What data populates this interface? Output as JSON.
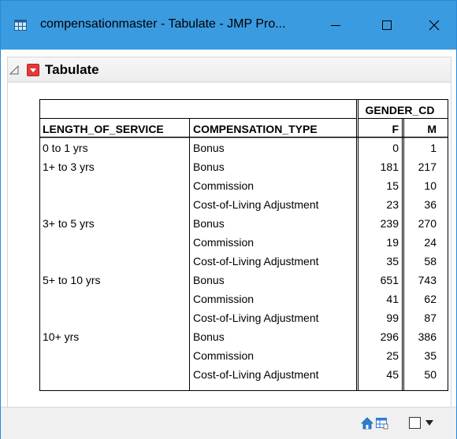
{
  "window": {
    "title": "compensationmaster - Tabulate - JMP Pro..."
  },
  "outline": {
    "title": "Tabulate"
  },
  "table": {
    "group_header": "GENDER_CD",
    "columns": [
      "LENGTH_OF_SERVICE",
      "COMPENSATION_TYPE",
      "F",
      "M"
    ],
    "rows": [
      [
        "0 to 1 yrs",
        "Bonus",
        "0",
        "1"
      ],
      [
        "1+ to 3 yrs",
        "Bonus",
        "181",
        "217"
      ],
      [
        "",
        "Commission",
        "15",
        "10"
      ],
      [
        "",
        "Cost-of-Living Adjustment",
        "23",
        "36"
      ],
      [
        "3+ to 5 yrs",
        "Bonus",
        "239",
        "270"
      ],
      [
        "",
        "Commission",
        "19",
        "24"
      ],
      [
        "",
        "Cost-of-Living Adjustment",
        "35",
        "58"
      ],
      [
        "5+ to 10 yrs",
        "Bonus",
        "651",
        "743"
      ],
      [
        "",
        "Commission",
        "41",
        "62"
      ],
      [
        "",
        "Cost-of-Living Adjustment",
        "99",
        "87"
      ],
      [
        "10+ yrs",
        "Bonus",
        "296",
        "386"
      ],
      [
        "",
        "Commission",
        "25",
        "35"
      ],
      [
        "",
        "Cost-of-Living Adjustment",
        "45",
        "50"
      ]
    ]
  },
  "icons": {
    "app": "jmp-table-icon",
    "minimize": "minimize-icon",
    "maximize": "maximize-icon",
    "close": "close-icon",
    "disclosure": "disclosure-triangle-icon",
    "red_menu": "red-triangle-menu-icon",
    "home": "home-icon",
    "table": "table-icon",
    "checkbox": "checkbox-icon",
    "dropdown": "dropdown-arrow-icon"
  },
  "colors": {
    "titlebar": "#3a9be0",
    "red_menu": "#e33a3a",
    "rule": "#000000"
  }
}
